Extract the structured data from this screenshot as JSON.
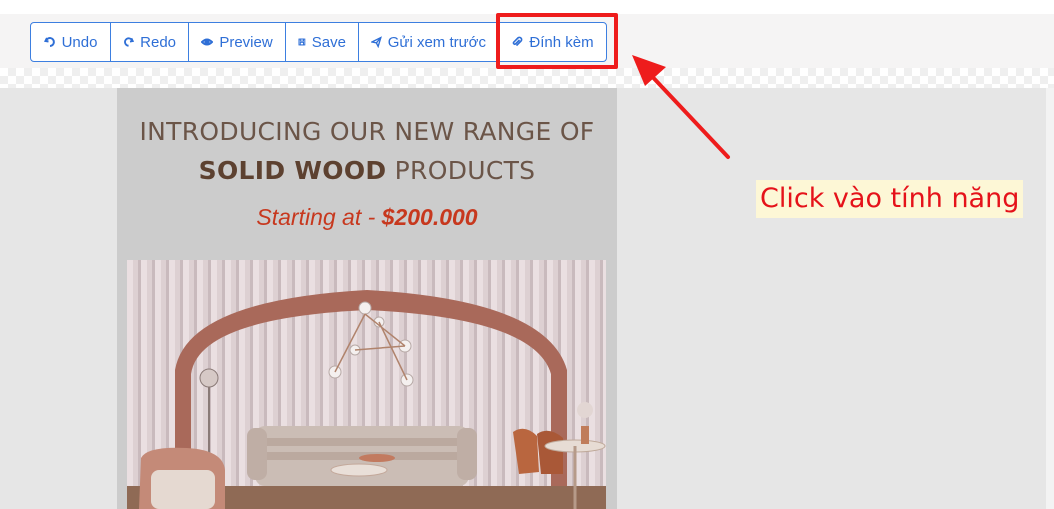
{
  "toolbar": {
    "buttons": [
      {
        "id": "undo",
        "label": "Undo",
        "icon": "undo-icon"
      },
      {
        "id": "redo",
        "label": "Redo",
        "icon": "redo-icon"
      },
      {
        "id": "preview",
        "label": "Preview",
        "icon": "eye-icon"
      },
      {
        "id": "save",
        "label": "Save",
        "icon": "floppy-disk-icon"
      },
      {
        "id": "send",
        "label": "Gửi xem trước",
        "icon": "paper-plane-icon"
      },
      {
        "id": "attach",
        "label": "Đính kèm",
        "icon": "paperclip-icon"
      }
    ]
  },
  "email": {
    "title_line1": "INTRODUCING OUR NEW RANGE OF",
    "title_bold": "SOLID WOOD",
    "title_rest": " PRODUCTS",
    "price_prefix": "Starting at - ",
    "price_value": "$200.000"
  },
  "annotation": {
    "text": "Click vào tính năng",
    "color": "#e5121a",
    "highlight_color": "#ee1c1c"
  }
}
